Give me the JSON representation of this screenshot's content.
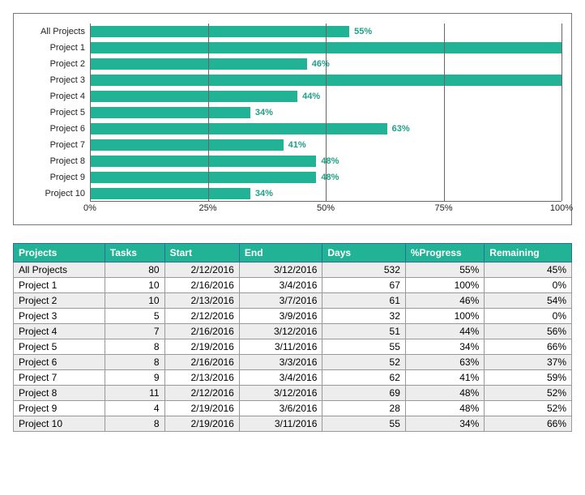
{
  "chart_data": {
    "type": "bar",
    "orientation": "horizontal",
    "categories": [
      "All Projects",
      "Project 1",
      "Project 2",
      "Project 3",
      "Project 4",
      "Project 5",
      "Project 6",
      "Project 7",
      "Project 8",
      "Project 9",
      "Project 10"
    ],
    "values": [
      55,
      100,
      46,
      100,
      44,
      34,
      63,
      41,
      48,
      48,
      34
    ],
    "value_labels": [
      "55%",
      "",
      "46%",
      "",
      "44%",
      "34%",
      "63%",
      "41%",
      "48%",
      "48%",
      "34%"
    ],
    "xlabel": "",
    "ylabel": "",
    "xlim": [
      0,
      100
    ],
    "x_ticks": [
      0,
      25,
      50,
      75,
      100
    ],
    "x_tick_labels": [
      "0%",
      "25%",
      "50%",
      "75%",
      "100%"
    ],
    "bar_color": "#22b396",
    "label_color": "#1e9f86"
  },
  "table": {
    "headers": [
      "Projects",
      "Tasks",
      "Start",
      "End",
      "Days",
      "%Progress",
      "Remaining"
    ],
    "rows": [
      {
        "project": "All Projects",
        "tasks": 80,
        "start": "2/12/2016",
        "end": "3/12/2016",
        "days": 532,
        "progress": "55%",
        "remaining": "45%"
      },
      {
        "project": "Project 1",
        "tasks": 10,
        "start": "2/16/2016",
        "end": "3/4/2016",
        "days": 67,
        "progress": "100%",
        "remaining": "0%"
      },
      {
        "project": "Project 2",
        "tasks": 10,
        "start": "2/13/2016",
        "end": "3/7/2016",
        "days": 61,
        "progress": "46%",
        "remaining": "54%"
      },
      {
        "project": "Project 3",
        "tasks": 5,
        "start": "2/12/2016",
        "end": "3/9/2016",
        "days": 32,
        "progress": "100%",
        "remaining": "0%"
      },
      {
        "project": "Project 4",
        "tasks": 7,
        "start": "2/16/2016",
        "end": "3/12/2016",
        "days": 51,
        "progress": "44%",
        "remaining": "56%"
      },
      {
        "project": "Project 5",
        "tasks": 8,
        "start": "2/19/2016",
        "end": "3/11/2016",
        "days": 55,
        "progress": "34%",
        "remaining": "66%"
      },
      {
        "project": "Project 6",
        "tasks": 8,
        "start": "2/16/2016",
        "end": "3/3/2016",
        "days": 52,
        "progress": "63%",
        "remaining": "37%"
      },
      {
        "project": "Project 7",
        "tasks": 9,
        "start": "2/13/2016",
        "end": "3/4/2016",
        "days": 62,
        "progress": "41%",
        "remaining": "59%"
      },
      {
        "project": "Project 8",
        "tasks": 11,
        "start": "2/12/2016",
        "end": "3/12/2016",
        "days": 69,
        "progress": "48%",
        "remaining": "52%"
      },
      {
        "project": "Project 9",
        "tasks": 4,
        "start": "2/19/2016",
        "end": "3/6/2016",
        "days": 28,
        "progress": "48%",
        "remaining": "52%"
      },
      {
        "project": "Project 10",
        "tasks": 8,
        "start": "2/19/2016",
        "end": "3/11/2016",
        "days": 55,
        "progress": "34%",
        "remaining": "66%"
      }
    ]
  }
}
